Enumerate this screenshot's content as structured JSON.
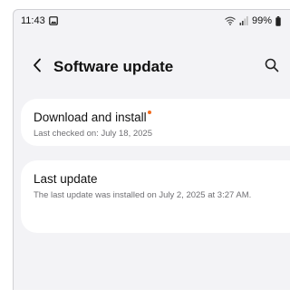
{
  "status_bar": {
    "time": "11:43",
    "battery": "99%",
    "icons": [
      "image-notification-icon",
      "wifi-icon",
      "signal-icon",
      "battery-icon"
    ]
  },
  "header": {
    "title": "Software update",
    "back_icon": "chevron-left-icon",
    "search_icon": "search-icon"
  },
  "download": {
    "title": "Download and install",
    "subtitle": "Last checked on: July 18, 2025",
    "badge_color": "#f26b1d"
  },
  "last_update": {
    "title": "Last update",
    "subtitle": "The last update was installed on July 2, 2025 at 3:27 AM."
  }
}
